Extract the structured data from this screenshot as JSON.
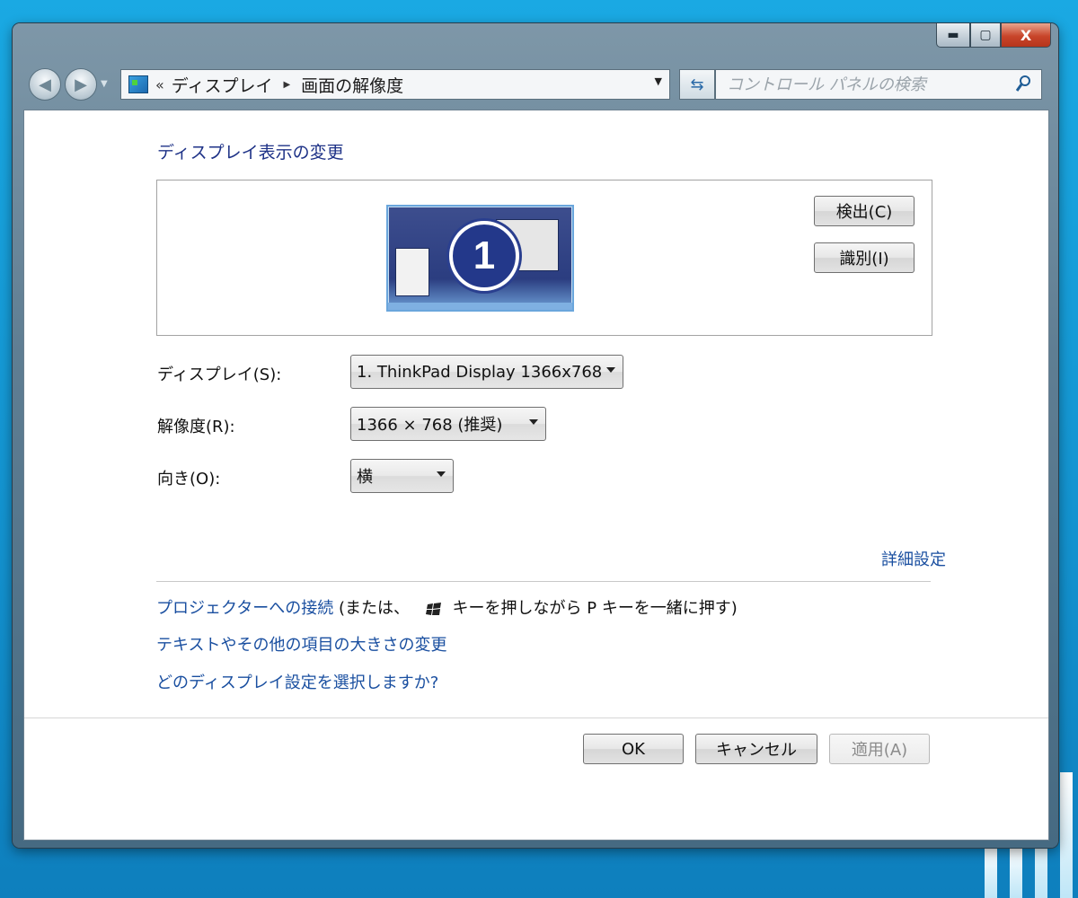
{
  "window": {
    "caption": {
      "minimize": "▬",
      "maximize": "▢",
      "close": "X"
    }
  },
  "nav": {
    "back_icon": "back-arrow-icon",
    "forward_icon": "forward-arrow-icon"
  },
  "address": {
    "prefix": "«",
    "crumbs": [
      "ディスプレイ",
      "画面の解像度"
    ],
    "icon": "control-panel-icon"
  },
  "search": {
    "placeholder": "コントロール パネルの検索"
  },
  "heading": "ディスプレイ表示の変更",
  "monitor": {
    "number": "1"
  },
  "buttons": {
    "detect": "検出(C)",
    "identify": "識別(I)",
    "ok": "OK",
    "cancel": "キャンセル",
    "apply": "適用(A)"
  },
  "fields": {
    "display": {
      "label": "ディスプレイ(S):",
      "value": "1. ThinkPad Display 1366x768"
    },
    "resolution": {
      "label": "解像度(R):",
      "value": "1366 × 768 (推奨)"
    },
    "orientation": {
      "label": "向き(O):",
      "value": "横"
    }
  },
  "links": {
    "advanced": "詳細設定",
    "projector": "プロジェクターへの接続",
    "projector_note_prefix": "(または、",
    "projector_note_suffix": "キーを押しながら P キーを一緒に押す)",
    "text_size": "テキストやその他の項目の大きさの変更",
    "which_setting": "どのディスプレイ設定を選択しますか?"
  },
  "colors": {
    "desktop": "#1aa9e3",
    "link": "#1a4fa0",
    "heading": "#1e3287",
    "close_button": "#c8452a"
  }
}
